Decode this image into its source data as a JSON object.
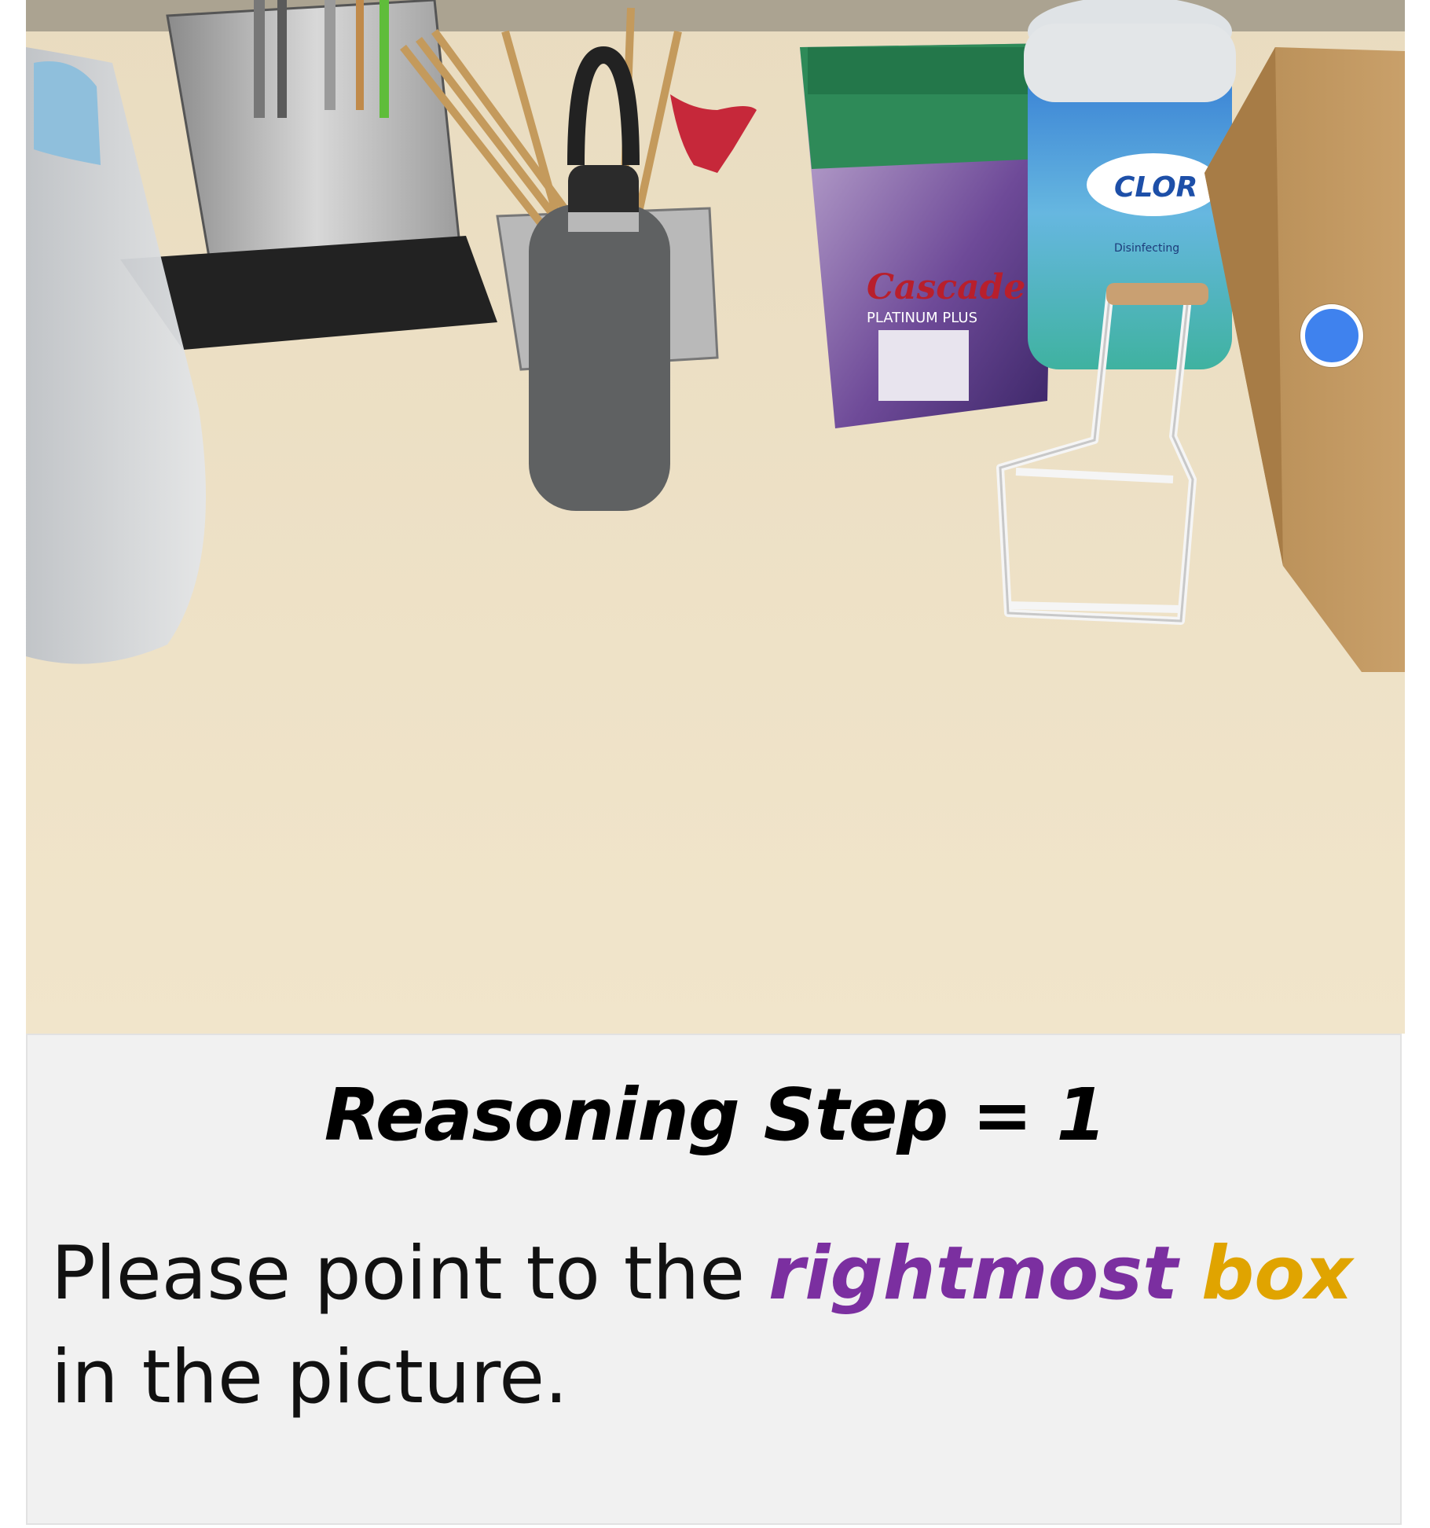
{
  "photo": {
    "description_labels": {
      "cascade_brand": "Cascade",
      "cascade_sub": "PLATINUM PLUS",
      "clorox_brand": "CLOR",
      "clorox_sub": "Disinfecting"
    }
  },
  "panel": {
    "title": "Reasoning Step = 1",
    "instruction_pre": "Please point to the ",
    "instruction_highlight_1": "rightmost",
    "instruction_space": " ",
    "instruction_highlight_2": "box",
    "instruction_post": " in the picture."
  },
  "colors": {
    "pointer": "#3f82ee",
    "highlight_purple": "#7b2fa0",
    "highlight_gold": "#e0a400",
    "panel_bg": "#f1f1f1"
  }
}
